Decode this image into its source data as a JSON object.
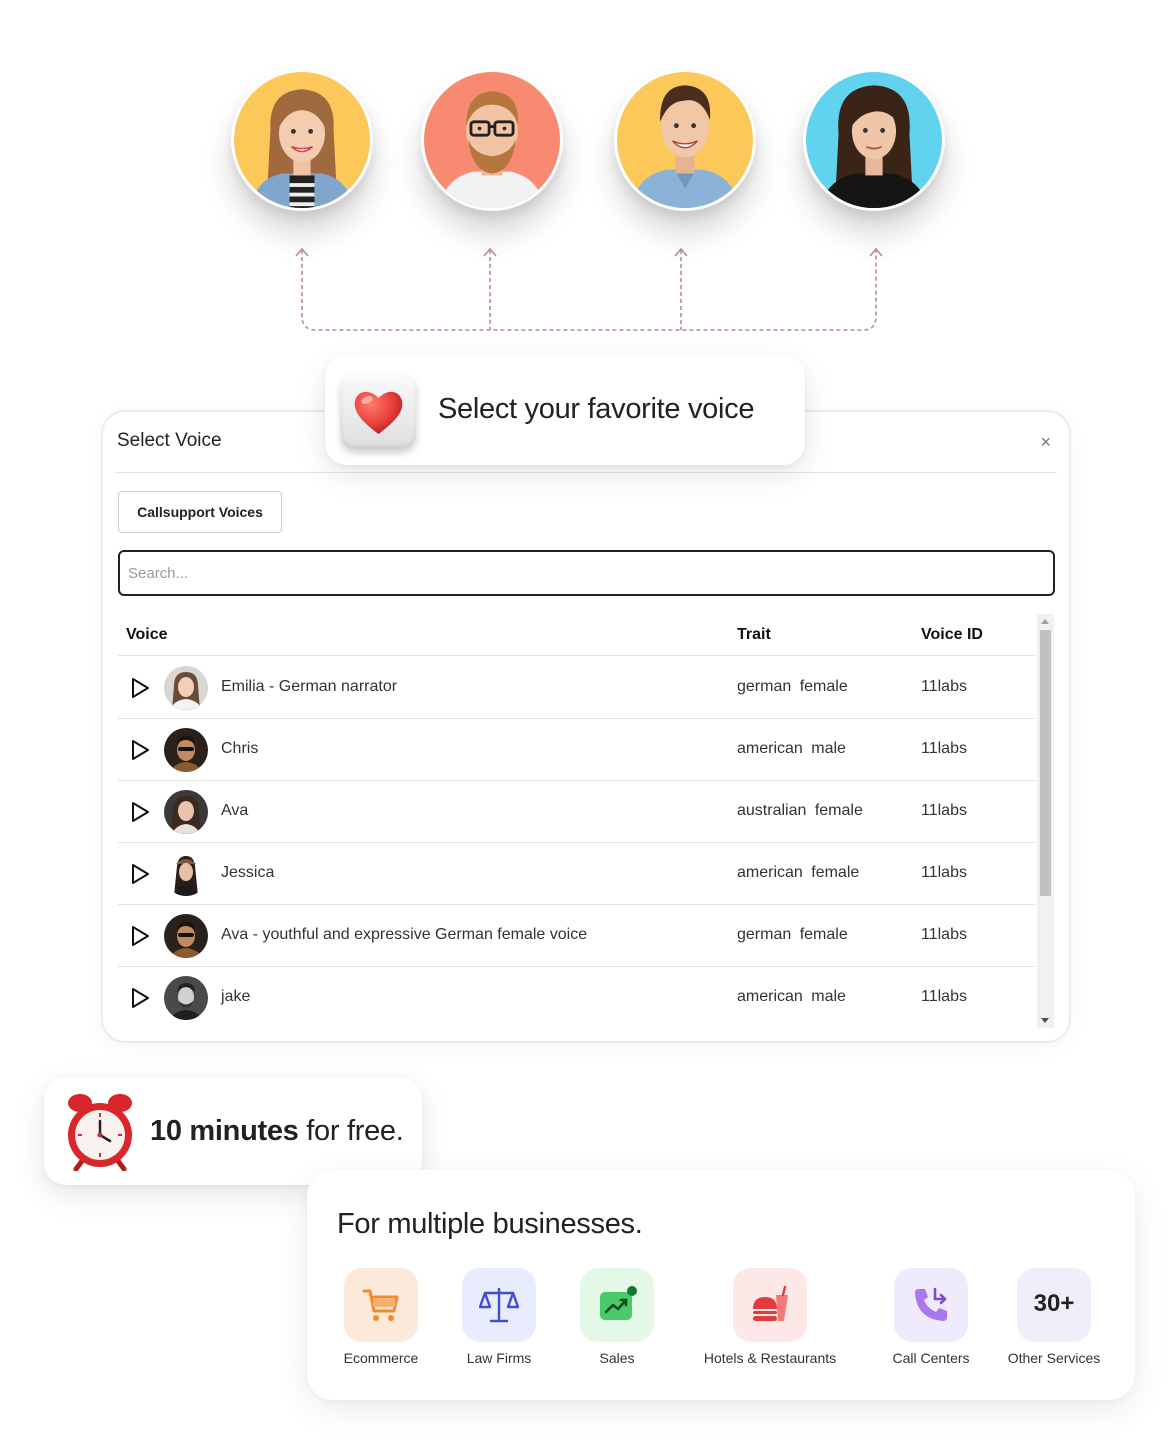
{
  "banner": {
    "text": "Select your favorite voice"
  },
  "modal": {
    "title": "Select Voice",
    "close": "×",
    "tab_label": "Callsupport Voices",
    "search_placeholder": "Search...",
    "columns": {
      "voice": "Voice",
      "trait": "Trait",
      "voice_id": "Voice ID"
    },
    "rows": [
      {
        "name": "Emilia - German narrator",
        "trait": "german female",
        "voice_id": "11labs"
      },
      {
        "name": "Chris",
        "trait": "american male",
        "voice_id": "11labs"
      },
      {
        "name": "Ava",
        "trait": "australian female",
        "voice_id": "11labs"
      },
      {
        "name": "Jessica",
        "trait": "american female",
        "voice_id": "11labs"
      },
      {
        "name": "Ava - youthful and expressive German female voice",
        "trait": "german female",
        "voice_id": "11labs"
      },
      {
        "name": "jake",
        "trait": "american male",
        "voice_id": "11labs"
      }
    ]
  },
  "free": {
    "bold": "10 minutes",
    "rest": " for free."
  },
  "business": {
    "title": "For multiple businesses.",
    "items": [
      {
        "label": "Ecommerce",
        "icon": "cart-icon"
      },
      {
        "label": "Law Firms",
        "icon": "scales-icon"
      },
      {
        "label": "Sales",
        "icon": "trend-up-icon"
      },
      {
        "label": "Hotels & Restaurants",
        "icon": "food-icon"
      },
      {
        "label": "Call Centers",
        "icon": "phone-icon"
      },
      {
        "label": "Other Services",
        "icon": "thirty-plus",
        "badge": "30+"
      }
    ]
  },
  "colors": {
    "avatar_yellow": "#fdc85a",
    "avatar_salmon": "#f88a72",
    "avatar_cyan": "#62d3ee",
    "heart_red": "#e8413a",
    "connector": "#b98c95"
  }
}
